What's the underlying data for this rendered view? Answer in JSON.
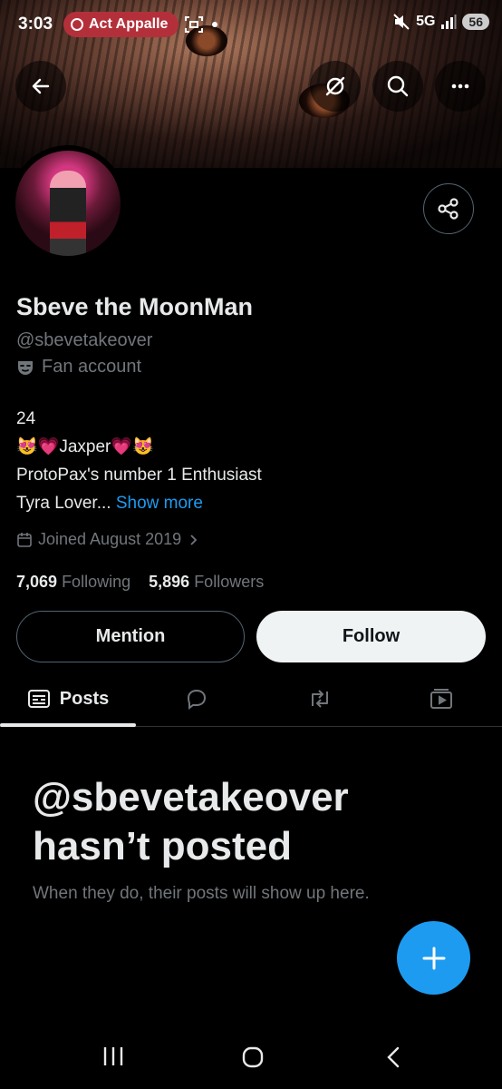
{
  "status_bar": {
    "time": "3:03",
    "notification": "Act Appalle",
    "network": "5G",
    "battery": "56"
  },
  "profile": {
    "display_name": "Sbeve the MoonMan",
    "handle": "@sbevetakeover",
    "category": "Fan account",
    "bio_lines": [
      "24",
      "😻💗Jaxper💗😻",
      "ProtoPax's number 1 Enthusiast"
    ],
    "bio_last": "Tyra Lover...",
    "show_more": "Show more",
    "joined": "Joined August 2019",
    "following_count": "7,069",
    "following_label": "Following",
    "followers_count": "5,896",
    "followers_label": "Followers"
  },
  "buttons": {
    "mention": "Mention",
    "follow": "Follow"
  },
  "tabs": {
    "posts": "Posts"
  },
  "empty_state": {
    "title_line1": "@sbevetakeover",
    "title_line2": "hasn’t posted",
    "subtitle": "When they do, their posts will show up here."
  },
  "colors": {
    "accent": "#1d9bf0",
    "background": "#000000",
    "muted_text": "#71767b"
  }
}
